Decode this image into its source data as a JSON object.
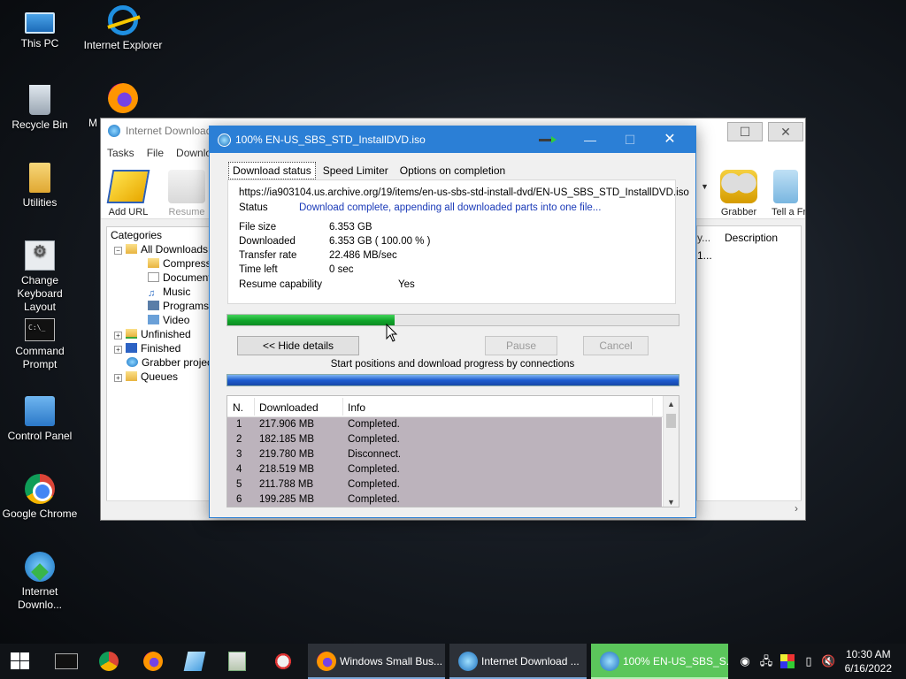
{
  "desktop": {
    "icons": [
      {
        "label": "This PC"
      },
      {
        "label": "Internet Explorer"
      },
      {
        "label": "Recycle Bin"
      },
      {
        "label": "M"
      },
      {
        "label": "Utilities"
      },
      {
        "label": "Change Keyboard Layout"
      },
      {
        "label": "Command Prompt"
      },
      {
        "label": "Control Panel"
      },
      {
        "label": "Google Chrome"
      },
      {
        "label": "Internet Downlo..."
      }
    ]
  },
  "main_window": {
    "title": "Internet Download",
    "menu": [
      "Tasks",
      "File",
      "Downlo"
    ],
    "toolbar": {
      "add_url": "Add URL",
      "resume": "Resume",
      "grabber": "Grabber",
      "tell": "Tell a Fri"
    },
    "categories_header": "Categories",
    "tree": [
      {
        "label": "All Downloads"
      },
      {
        "label": "Compresse"
      },
      {
        "label": "Documents"
      },
      {
        "label": "Music"
      },
      {
        "label": "Programs"
      },
      {
        "label": "Video"
      },
      {
        "label": "Unfinished"
      },
      {
        "label": "Finished"
      },
      {
        "label": "Grabber projec"
      },
      {
        "label": "Queues"
      }
    ],
    "list": {
      "col_partial": "y...",
      "col_description": "Description",
      "cell_partial": "1..."
    }
  },
  "dialog": {
    "title": "100% EN-US_SBS_STD_InstallDVD.iso",
    "tabs": [
      "Download status",
      "Speed Limiter",
      "Options on completion"
    ],
    "url": "https://ia903104.us.archive.org/19/items/en-us-sbs-std-install-dvd/EN-US_SBS_STD_InstallDVD.iso",
    "status_label": "Status",
    "status_value": "Download complete, appending all downloaded parts into one file...",
    "fields": [
      {
        "label": "File size",
        "value": "6.353  GB"
      },
      {
        "label": "Downloaded",
        "value": "6.353  GB  ( 100.00 % )"
      },
      {
        "label": "Transfer rate",
        "value": "22.486  MB/sec"
      },
      {
        "label": "Time left",
        "value": "0 sec"
      }
    ],
    "resume_label": "Resume capability",
    "resume_value": "Yes",
    "progress_fraction": 0.37,
    "buttons": {
      "hide_details": "<< Hide details",
      "pause": "Pause",
      "cancel": "Cancel"
    },
    "connections_label": "Start positions and download progress by connections",
    "table": {
      "headers": [
        "N.",
        "Downloaded",
        "Info"
      ],
      "rows": [
        {
          "n": "1",
          "downloaded": "217.906  MB",
          "info": "Completed."
        },
        {
          "n": "2",
          "downloaded": "182.185  MB",
          "info": "Completed."
        },
        {
          "n": "3",
          "downloaded": "219.780  MB",
          "info": "Disconnect."
        },
        {
          "n": "4",
          "downloaded": "218.519  MB",
          "info": "Completed."
        },
        {
          "n": "5",
          "downloaded": "211.788  MB",
          "info": "Completed."
        },
        {
          "n": "6",
          "downloaded": "199.285  MB",
          "info": "Completed."
        }
      ]
    }
  },
  "taskbar": {
    "tasks": [
      {
        "label": "Windows Small Bus..."
      },
      {
        "label": "Internet Download ..."
      },
      {
        "label": "100% EN-US_SBS_S..."
      }
    ],
    "time": "10:30 AM",
    "date": "6/16/2022"
  },
  "colors": {
    "accent": "#2b7fd6",
    "progress": "#10a52a",
    "active_task": "#5bc65b"
  }
}
